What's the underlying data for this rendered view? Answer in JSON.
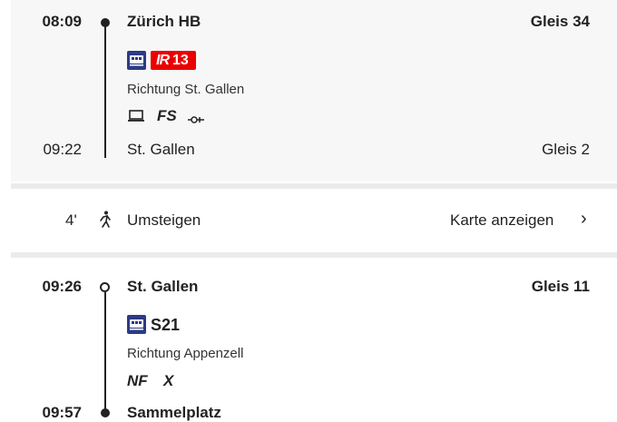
{
  "leg1": {
    "departure": {
      "time": "08:09",
      "station": "Zürich HB",
      "platform": "Gleis 34"
    },
    "train": {
      "brand": "IR",
      "number": "13"
    },
    "direction": "Richtung St. Gallen",
    "features": [
      "FS"
    ],
    "arrival": {
      "time": "09:22",
      "station": "St. Gallen",
      "platform": "Gleis 2"
    }
  },
  "transfer": {
    "minutes": "4'",
    "label": "Umsteigen",
    "map_link": "Karte anzeigen",
    "chevron": "›"
  },
  "leg2": {
    "departure": {
      "time": "09:26",
      "station": "St. Gallen",
      "platform": "Gleis 11"
    },
    "train": {
      "line": "S21"
    },
    "direction": "Richtung Appenzell",
    "features": [
      "NF",
      "X"
    ],
    "arrival": {
      "time": "09:57",
      "station": "Sammelplatz"
    }
  },
  "icons": [
    "train-icon",
    "laptop-icon",
    "coupling-icon",
    "walking-icon",
    "chevron-right-icon"
  ],
  "colors": {
    "ir_red": "#eb0000",
    "train_blue": "#2d3a85",
    "text": "#222222"
  }
}
